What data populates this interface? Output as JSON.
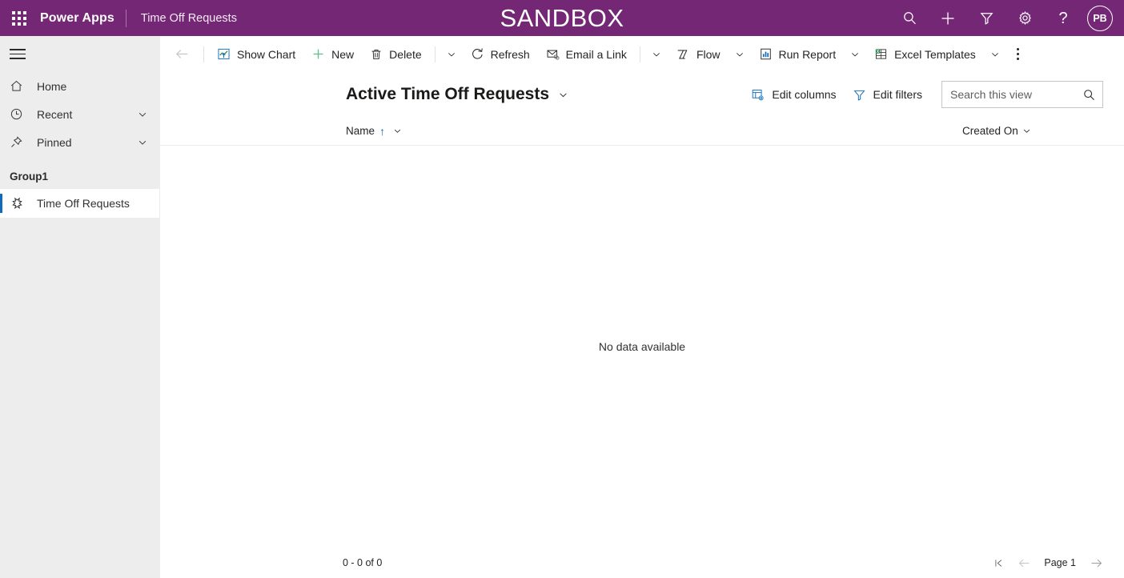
{
  "appbar": {
    "waffle_name": "app-launcher",
    "brand": "Power Apps",
    "app_name": "Time Off Requests",
    "environment_banner": "SANDBOX",
    "search_icon": "search-icon",
    "new_icon": "plus-icon",
    "filter_icon": "filter-icon",
    "settings_icon": "gear-icon",
    "help_icon": "help-icon",
    "avatar_initials": "PB",
    "brand_color": "#742774"
  },
  "sidebar": {
    "hamburger_label": "hamburger-menu",
    "items": [
      {
        "label": "Home",
        "icon": "home-icon",
        "has_chevron": false,
        "selected": false
      },
      {
        "label": "Recent",
        "icon": "clock-icon",
        "has_chevron": true,
        "selected": false
      },
      {
        "label": "Pinned",
        "icon": "pin-icon",
        "has_chevron": true,
        "selected": false
      }
    ],
    "group_label": "Group1",
    "entity": {
      "label": "Time Off Requests",
      "icon": "entity-icon",
      "selected": true
    },
    "selection_color": "#0f6cbd"
  },
  "commandbar": {
    "back_label": "back-arrow",
    "items": [
      {
        "label": "Show Chart",
        "icon": "show-chart-icon",
        "chevron": false
      },
      {
        "label": "New",
        "icon": "plus-icon",
        "chevron": false
      },
      {
        "label": "Delete",
        "icon": "trash-icon",
        "chevron": true
      },
      {
        "label": "Refresh",
        "icon": "refresh-icon",
        "chevron": false
      },
      {
        "label": "Email a Link",
        "icon": "email-link-icon",
        "chevron": true
      },
      {
        "label": "Flow",
        "icon": "flow-icon",
        "chevron": true
      },
      {
        "label": "Run Report",
        "icon": "run-report-icon",
        "chevron": true
      },
      {
        "label": "Excel Templates",
        "icon": "excel-templates-icon",
        "chevron": true
      }
    ],
    "overflow_label": "more-commands"
  },
  "view": {
    "title": "Active Time Off Requests",
    "title_chevron": "chevron-down-icon",
    "edit_columns": "Edit columns",
    "edit_filters": "Edit filters",
    "search": {
      "placeholder": "Search this view",
      "value": "",
      "icon": "search-icon"
    }
  },
  "grid": {
    "columns": [
      {
        "label": "Name",
        "sort": "ascending",
        "sort_glyph": "↑"
      },
      {
        "label": "Created On",
        "sort": "none",
        "sort_glyph": ""
      }
    ],
    "rows": [],
    "empty_message": "No data available"
  },
  "footer": {
    "record_count": "0 - 0 of 0",
    "first_page_label": "first-page",
    "previous_page_label": "previous-page",
    "page_label": "Page 1",
    "next_page_label": "next-page"
  }
}
